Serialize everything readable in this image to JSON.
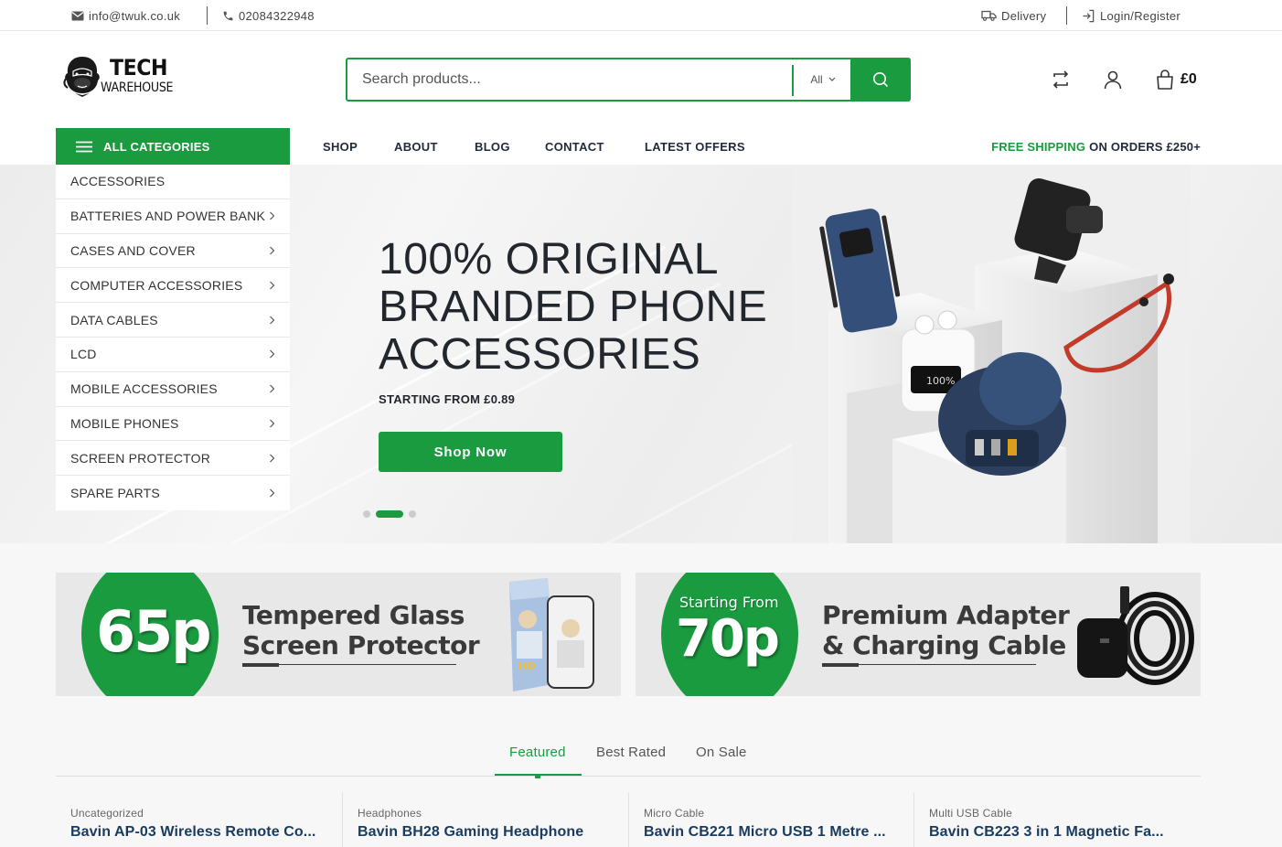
{
  "topbar": {
    "email": "info@twuk.co.uk",
    "phone": "02084322948",
    "delivery": "Delivery",
    "login": "Login/Register"
  },
  "logo": {
    "line1": "TECH",
    "line2": "WAREHOUSE"
  },
  "search": {
    "placeholder": "Search products...",
    "category": "All"
  },
  "cart": {
    "amount": "£0"
  },
  "nav": {
    "all_categories": "ALL CATEGORIES",
    "items": [
      "SHOP",
      "ABOUT",
      "BLOG",
      "CONTACT",
      "LATEST OFFERS"
    ],
    "free_shipping_green": "FREE SHIPPING",
    "free_shipping_rest": "ON ORDERS £250+"
  },
  "categories": [
    "ACCESSORIES",
    "BATTERIES AND POWER BANK",
    "CASES AND COVER",
    "COMPUTER ACCESSORIES",
    "DATA CABLES",
    "LCD",
    "MOBILE ACCESSORIES",
    "MOBILE PHONES",
    "SCREEN PROTECTOR",
    "SPARE PARTS"
  ],
  "hero": {
    "title_line1": "100% ORIGINAL",
    "title_line2": "BRANDED PHONE",
    "title_line3": "ACCESSORIES",
    "subtitle": "STARTING FROM £0.89",
    "button": "Shop Now",
    "active_slide": 2,
    "slide_count": 3
  },
  "promos": [
    {
      "price": "65p",
      "prefix": "",
      "title_line1": "Tempered Glass",
      "title_line2": "Screen Protector"
    },
    {
      "price": "70p",
      "prefix": "Starting From",
      "title_line1": "Premium Adapter",
      "title_line2": "& Charging Cable"
    }
  ],
  "tabs": [
    "Featured",
    "Best Rated",
    "On Sale"
  ],
  "products": [
    {
      "category": "Uncategorized",
      "name": "Bavin AP-03 Wireless Remote Co..."
    },
    {
      "category": "Headphones",
      "name": "Bavin BH28 Gaming Headphone"
    },
    {
      "category": "Micro Cable",
      "name": "Bavin CB221 Micro USB 1 Metre ..."
    },
    {
      "category": "Multi USB Cable",
      "name": "Bavin CB223 3 in 1 Magnetic Fa..."
    }
  ],
  "colors": {
    "accent": "#1a9b3f",
    "text": "#1f2a3a",
    "product_name": "#1a3b5d"
  }
}
